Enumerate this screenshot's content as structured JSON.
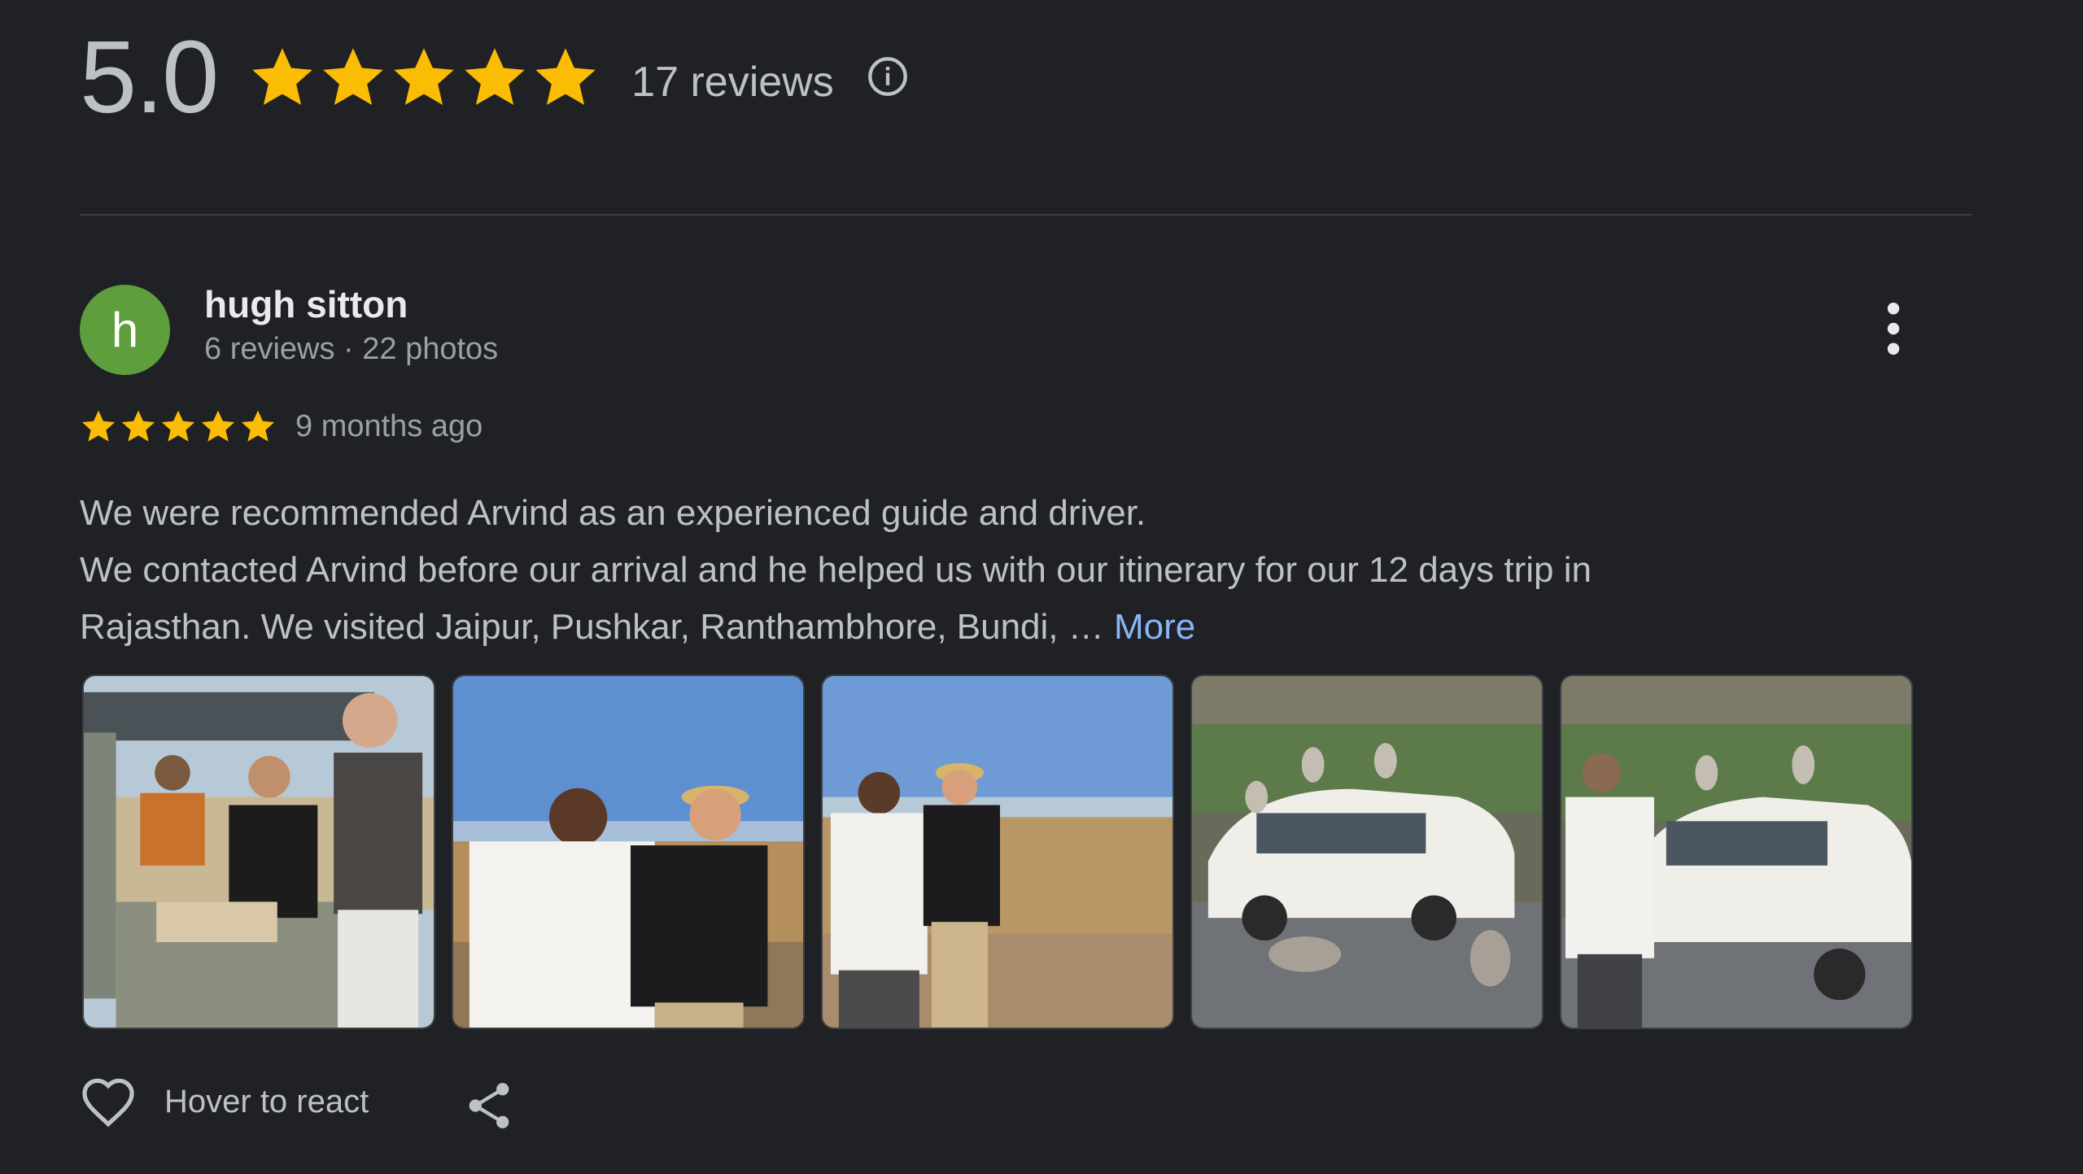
{
  "summary": {
    "score": "5.0",
    "stars": 5,
    "review_count": "17 reviews",
    "info_icon": "info-icon",
    "star_color": "#fbbc04"
  },
  "review": {
    "avatar_letter": "h",
    "avatar_color": "#5e9e3c",
    "name": "hugh sitton",
    "meta": "6 reviews · 22 photos",
    "rating": 5,
    "date": "9 months ago",
    "text_line_1": "We were recommended Arvind as an experienced guide and driver.",
    "text_line_2": "We contacted Arvind before our arrival and he helped us with our itinerary for our 12 days trip in",
    "text_line_3": "Rajasthan. We visited Jaipur, Pushkar, Ranthambhore, Bundi, … ",
    "more_label": "More",
    "more_link_color": "#8ab4f8",
    "photos": [
      {
        "subject": "men-in-safari-jeep"
      },
      {
        "subject": "two-men-at-sunset"
      },
      {
        "subject": "two-men-in-field"
      },
      {
        "subject": "monkeys-on-white-car"
      },
      {
        "subject": "man-with-monkeys-and-car"
      }
    ]
  },
  "actions": {
    "react_label": "Hover to react",
    "react_icon": "heart-icon",
    "share_icon": "share-icon"
  }
}
